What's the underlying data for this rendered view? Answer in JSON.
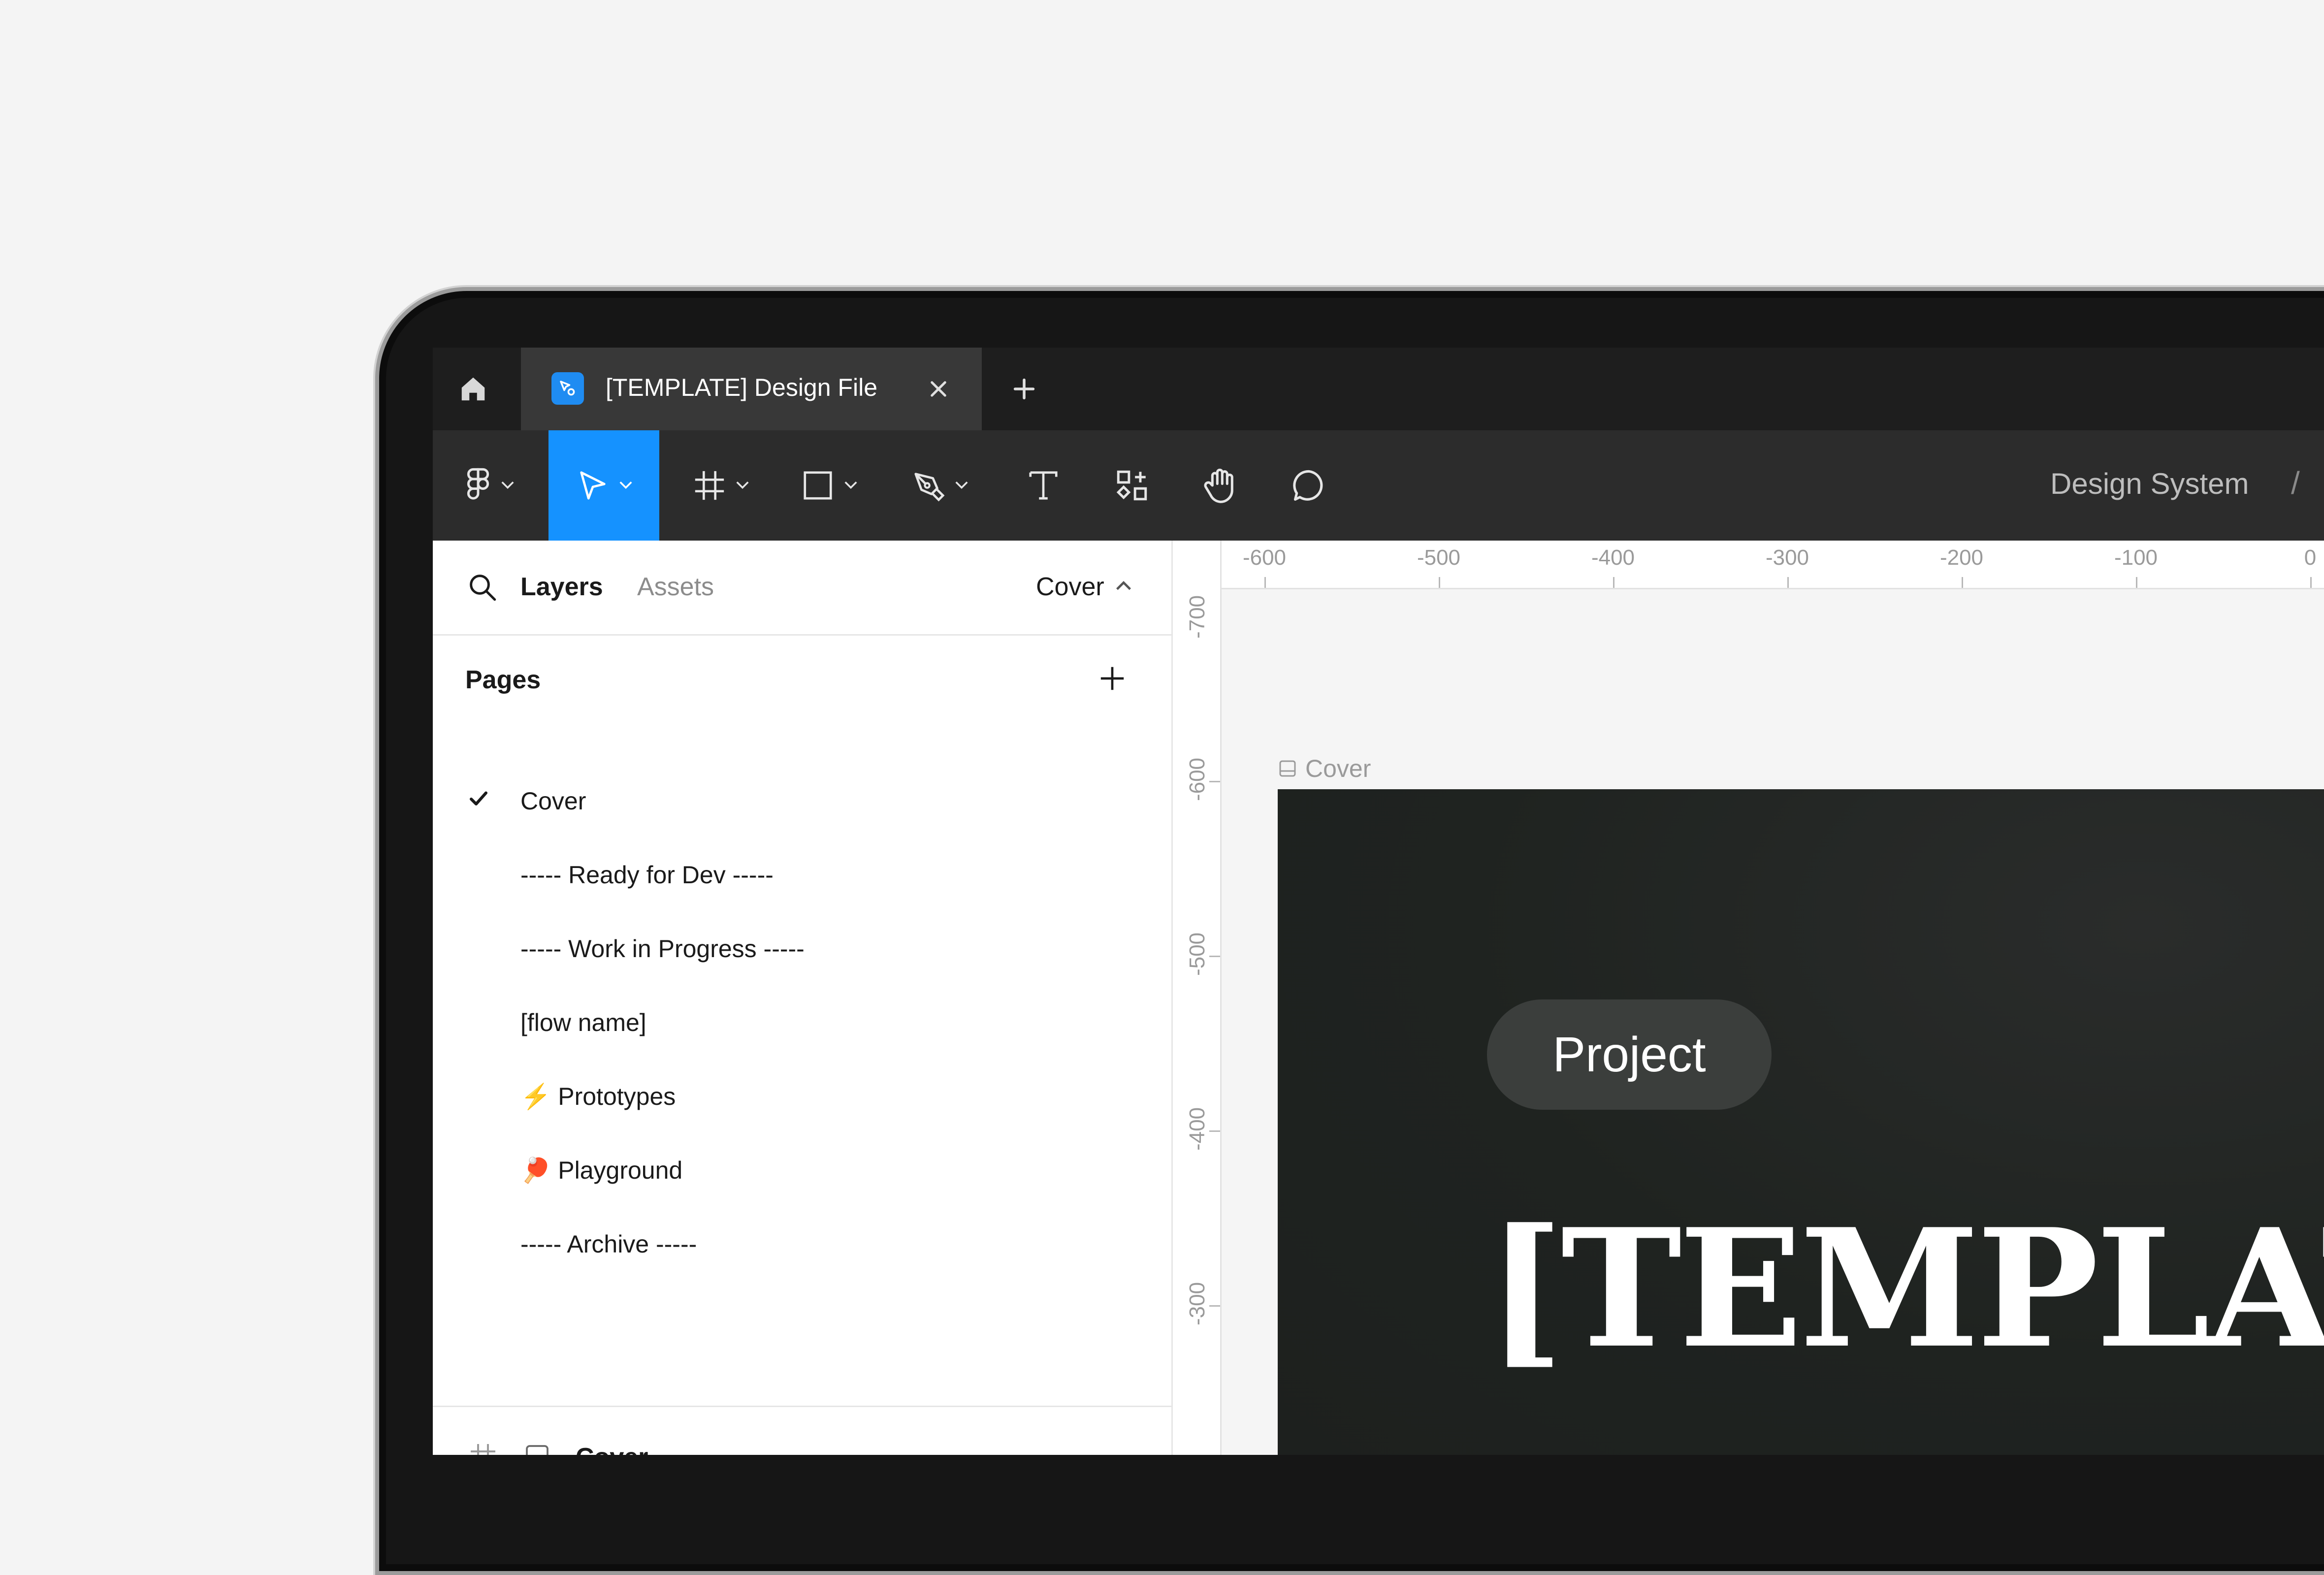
{
  "tabbar": {
    "tab_title": "[TEMPLATE] Design File"
  },
  "toolbar": {
    "tools": [
      "figma-menu",
      "move",
      "frame",
      "shape",
      "pen",
      "text",
      "resources",
      "hand",
      "comment"
    ],
    "active_tool": "move",
    "breadcrumb": "Design System",
    "breadcrumb_sep": "/"
  },
  "left_panel": {
    "tabs": {
      "layers": "Layers",
      "assets": "Assets"
    },
    "current_page": "Cover",
    "pages_header": "Pages",
    "pages": [
      {
        "label": "Cover",
        "selected": true,
        "emoji": ""
      },
      {
        "label": "----- Ready for Dev -----",
        "selected": false,
        "emoji": ""
      },
      {
        "label": "----- Work in Progress -----",
        "selected": false,
        "emoji": ""
      },
      {
        "label": "[flow name]",
        "selected": false,
        "emoji": ""
      },
      {
        "label": "Prototypes",
        "selected": false,
        "emoji": "⚡"
      },
      {
        "label": "Playground",
        "selected": false,
        "emoji": "🏓"
      },
      {
        "label": "----- Archive -----",
        "selected": false,
        "emoji": ""
      }
    ],
    "layer_name": "Cover"
  },
  "canvas": {
    "ruler_h": [
      "-600",
      "-500",
      "-400",
      "-300",
      "-200",
      "-100",
      "0"
    ],
    "ruler_v": [
      "-700",
      "-600",
      "-500",
      "-400",
      "-300"
    ],
    "frame_label": "Cover",
    "pill_text": "Project",
    "cover_title": "[TEMPLATE]"
  },
  "colors": {
    "accent": "#1592ff",
    "toolbar_bg": "#2c2c2c",
    "cover_bg": "#1f2320"
  }
}
